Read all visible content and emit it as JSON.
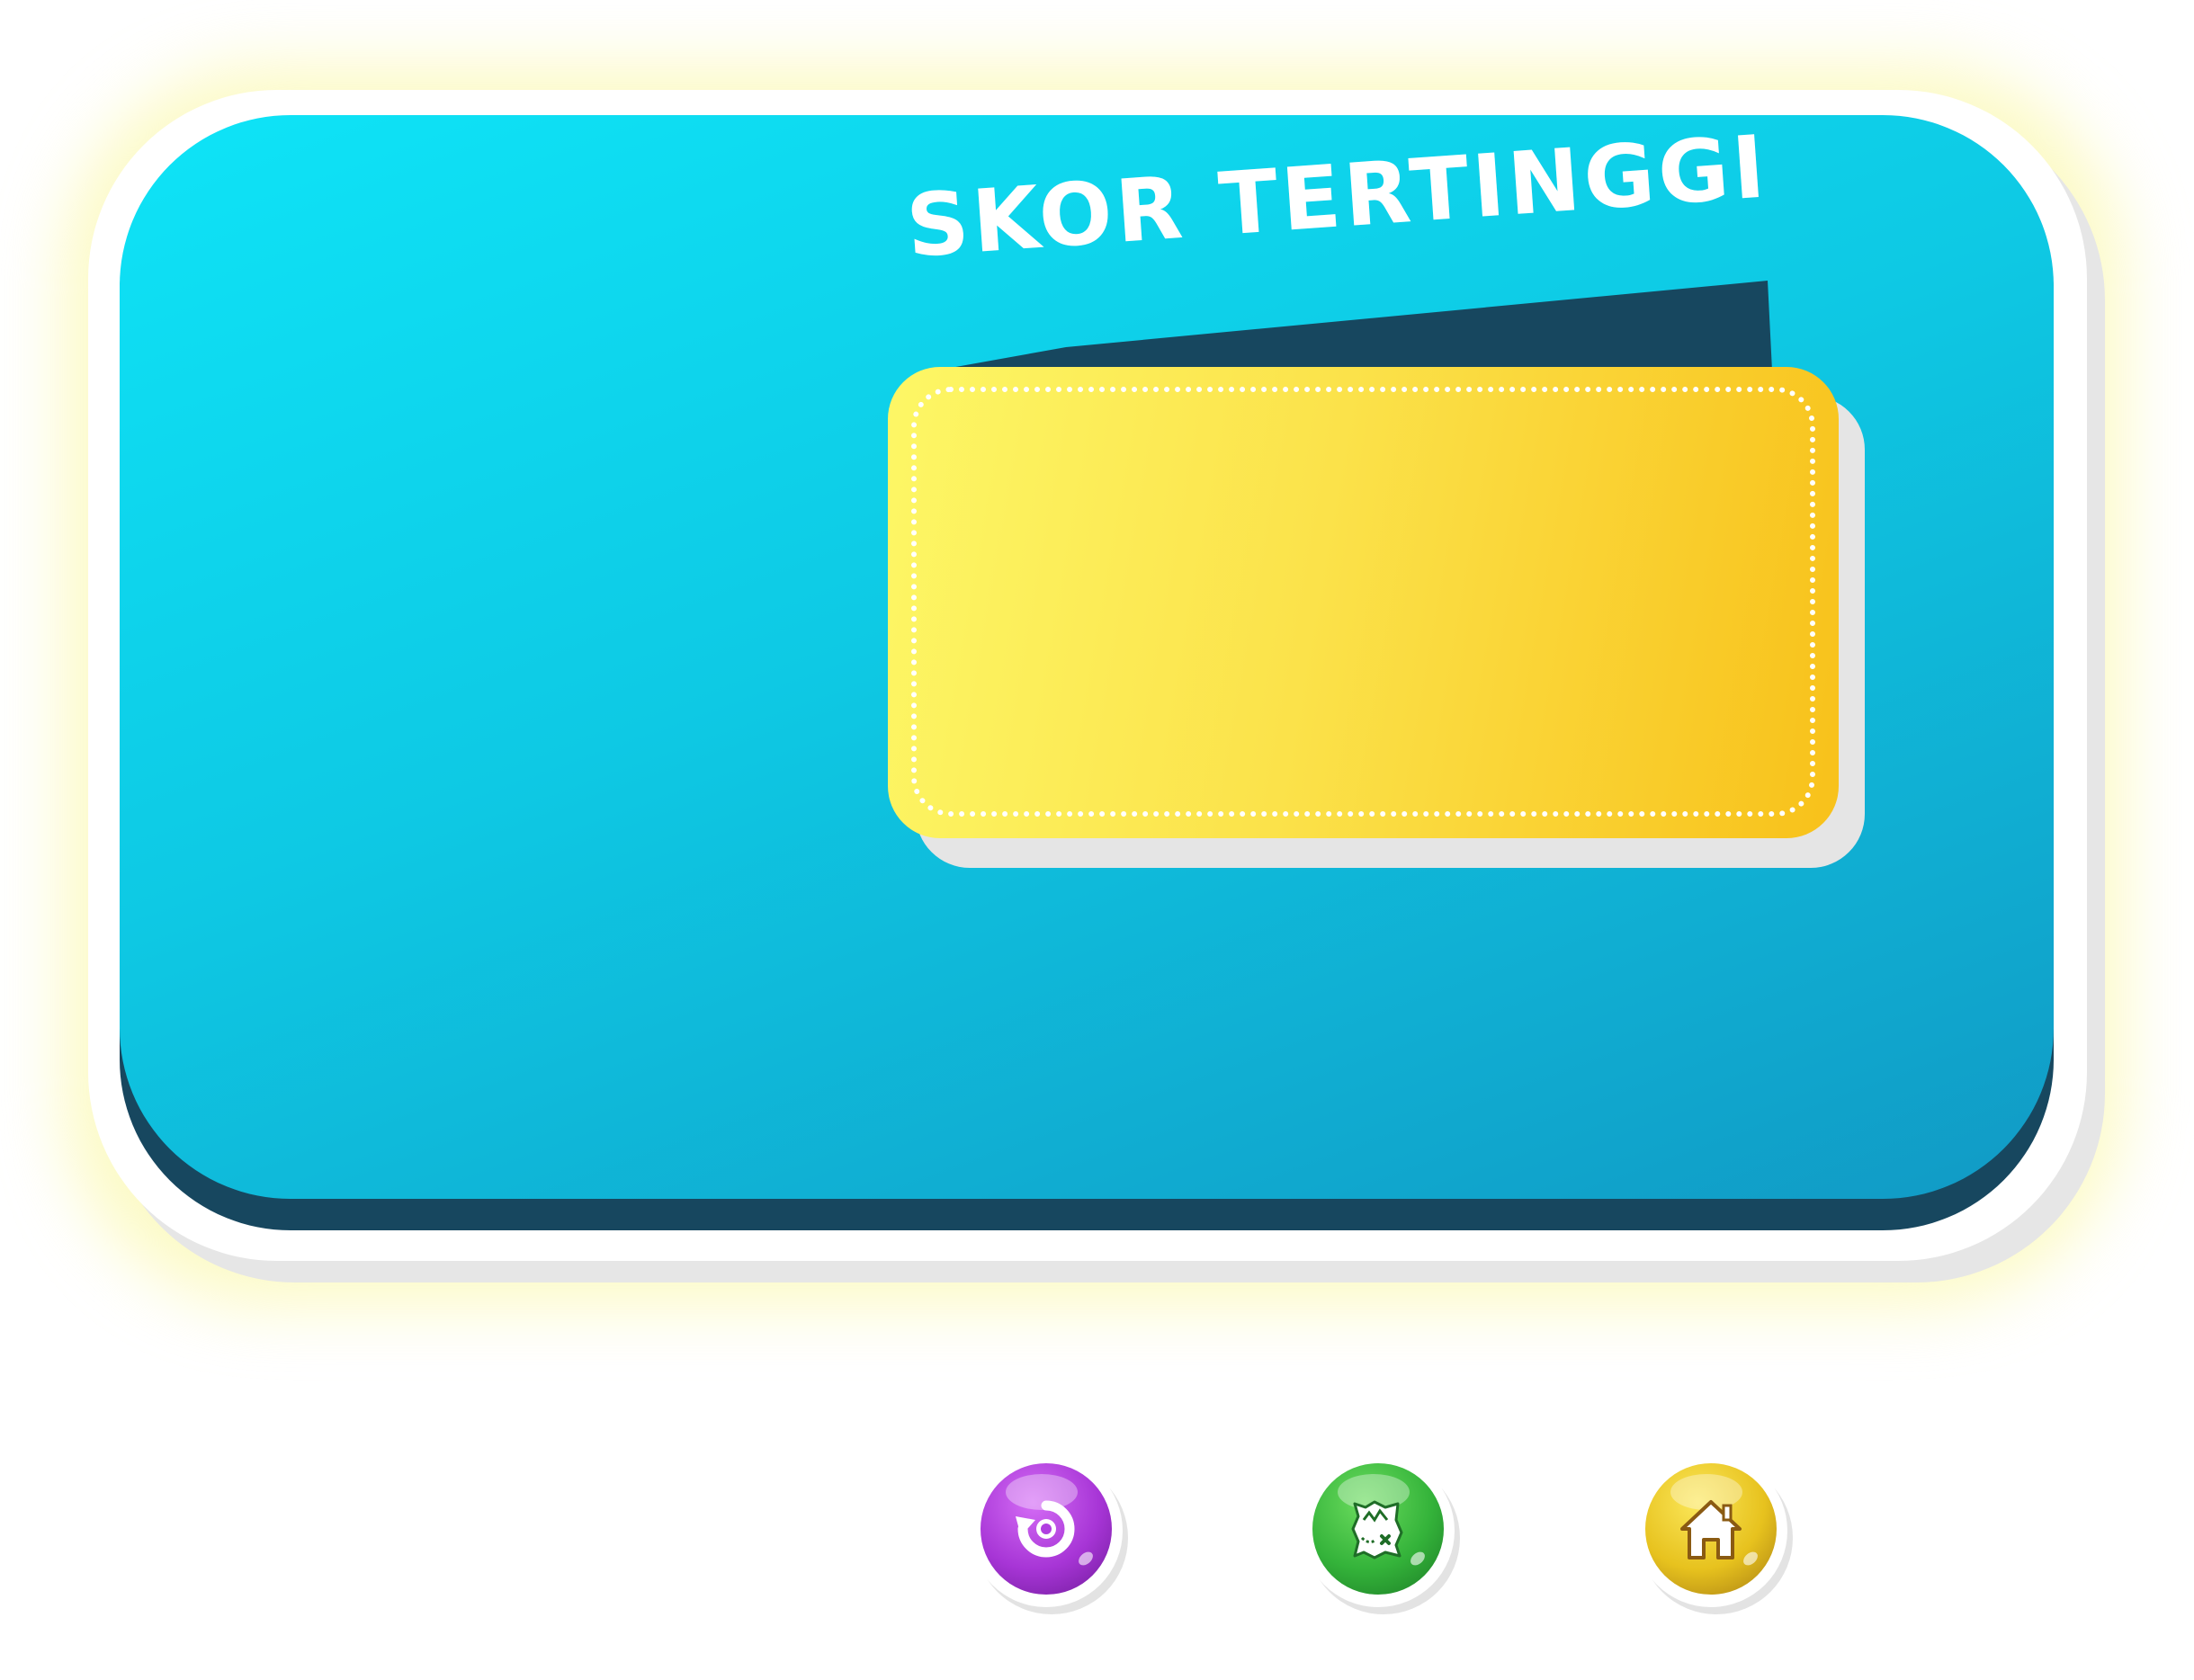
{
  "panel": {
    "title": "SKOR TERTINGGI",
    "score": "",
    "colors": {
      "panel_light": "#0ee4f7",
      "panel_dark": "#119ac5",
      "panel_depth": "#17475f",
      "score_light": "#fdf766",
      "score_dark": "#f8c11a",
      "glow": "#faf596"
    }
  },
  "buttons": [
    {
      "id": "retry",
      "icon": "retry-icon",
      "color": "#a735d6"
    },
    {
      "id": "map",
      "icon": "map-icon",
      "color": "#34b33a"
    },
    {
      "id": "home",
      "icon": "home-icon",
      "color": "#e7c21e"
    }
  ]
}
